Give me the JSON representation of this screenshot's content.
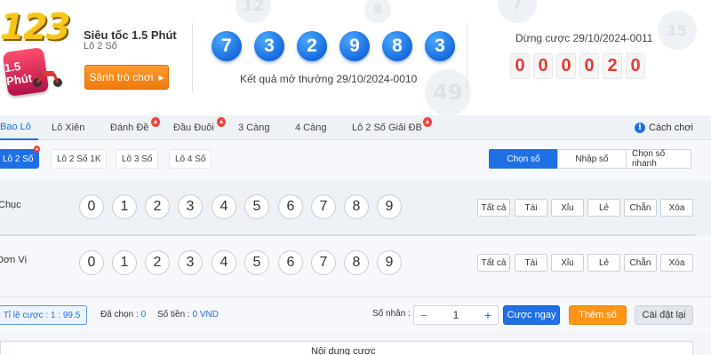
{
  "header": {
    "logo_text": "123",
    "logo_badge": "1.5 Phút",
    "game_title": "Siêu tốc 1.5 Phút",
    "game_sub": "Lô 2 Số",
    "lobby_button": "Sảnh trò chơi",
    "result_balls": [
      "7",
      "3",
      "2",
      "9",
      "8",
      "3"
    ],
    "result_label": "Kết quả mở thưởng 29/10/2024-0010",
    "stop_label": "Dừng cược 29/10/2024-0011",
    "countdown": [
      "0",
      "0",
      "0",
      "0",
      "2",
      "0"
    ],
    "background_numbers": [
      "12",
      "8",
      "49",
      "7",
      "15"
    ]
  },
  "tabs": [
    {
      "label": "Bao Lô",
      "active": true,
      "hot": false
    },
    {
      "label": "Lô Xiên",
      "active": false,
      "hot": false
    },
    {
      "label": "Đánh Đề",
      "active": false,
      "hot": true
    },
    {
      "label": "Đầu Đuôi",
      "active": false,
      "hot": true
    },
    {
      "label": "3 Càng",
      "active": false,
      "hot": false
    },
    {
      "label": "4 Càng",
      "active": false,
      "hot": false
    },
    {
      "label": "Lô 2 Số Giải ĐB",
      "active": false,
      "hot": true
    }
  ],
  "help_label": "Cách chơi",
  "subtabs": [
    {
      "label": "Lô 2 Số",
      "active": true
    },
    {
      "label": "Lô 2 Số 1K",
      "active": false
    },
    {
      "label": "Lô 3 Số",
      "active": false
    },
    {
      "label": "Lô 4 Số",
      "active": false
    }
  ],
  "modes": [
    {
      "label": "Chọn số",
      "active": true
    },
    {
      "label": "Nhập số",
      "active": false
    },
    {
      "label": "Chọn số nhanh",
      "active": false
    }
  ],
  "rows": [
    {
      "label": "Chục",
      "numbers": [
        "0",
        "1",
        "2",
        "3",
        "4",
        "5",
        "6",
        "7",
        "8",
        "9"
      ]
    },
    {
      "label": "Đơn Vị",
      "numbers": [
        "0",
        "1",
        "2",
        "3",
        "4",
        "5",
        "6",
        "7",
        "8",
        "9"
      ]
    }
  ],
  "quick_buttons": [
    "Tất cả",
    "Tài",
    "Xỉu",
    "Lẻ",
    "Chẵn",
    "Xóa"
  ],
  "bottom": {
    "ratio": "Tỉ lệ cược : 1 : 99.5",
    "selected_label": "Đã chọn :",
    "selected_value": "0",
    "amount_label": "Số tiền :",
    "amount_value": "0 VND",
    "multiplier_label": "Số nhân :",
    "multiplier_minus": "−",
    "multiplier_value": "1",
    "multiplier_plus": "+",
    "bet_now": "Cược ngay",
    "add_number": "Thêm số",
    "reset": "Cài đặt lại"
  },
  "content_title": "Nội dung cược",
  "hot_icon": "fire-icon",
  "colors": {
    "accent": "#1f6fe5",
    "orange": "#ff9417",
    "countdown": "#e53935"
  }
}
